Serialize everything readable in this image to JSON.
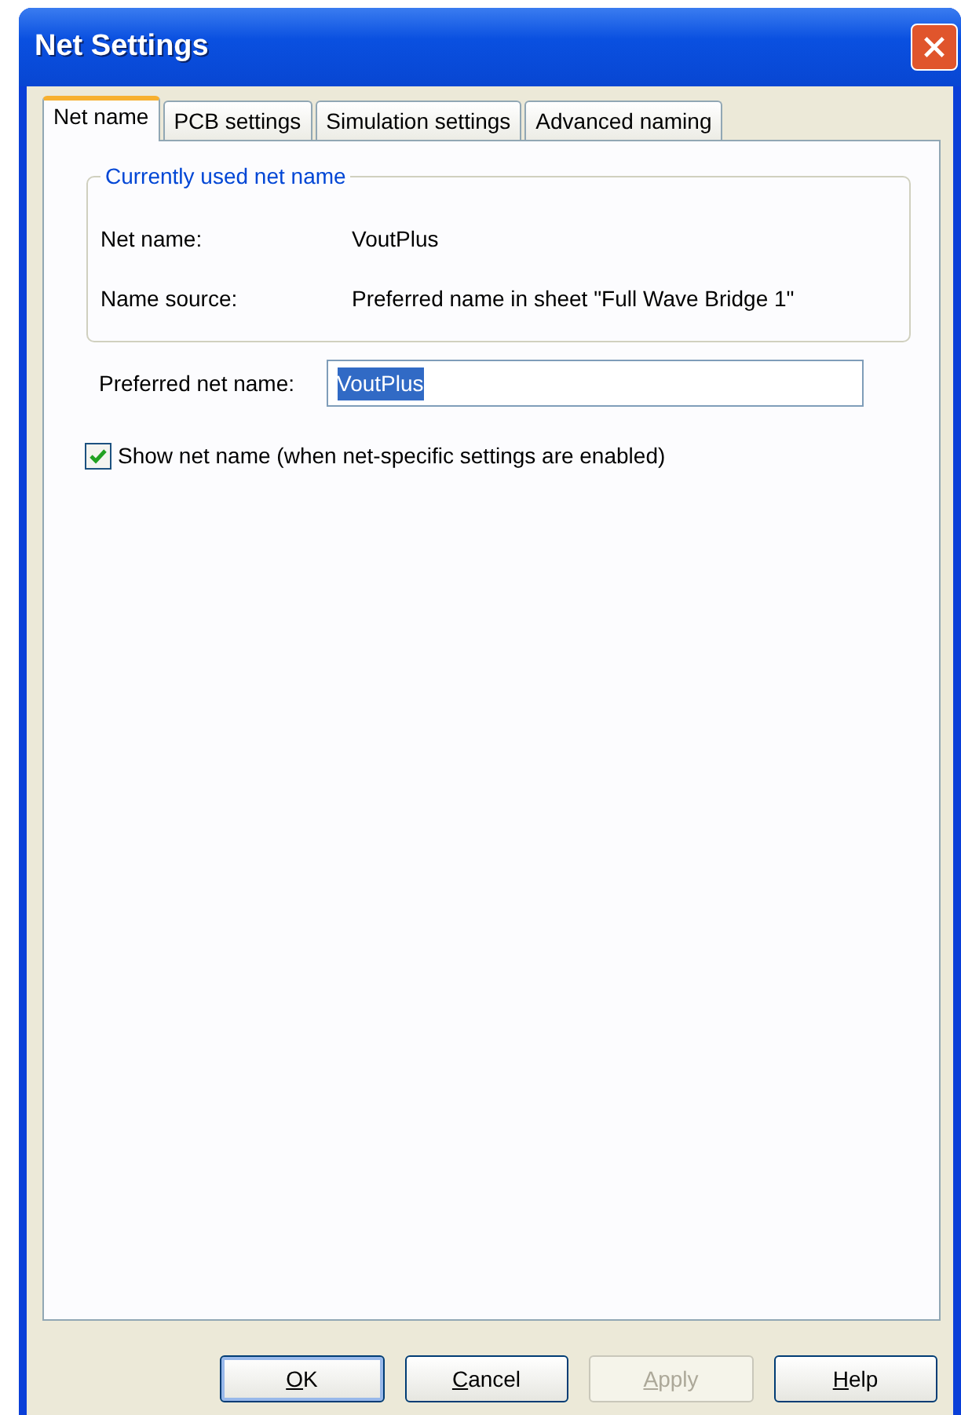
{
  "window": {
    "title": "Net Settings"
  },
  "tabs": [
    {
      "label": "Net name",
      "selected": true
    },
    {
      "label": "PCB settings",
      "selected": false
    },
    {
      "label": "Simulation settings",
      "selected": false
    },
    {
      "label": "Advanced naming",
      "selected": false
    }
  ],
  "group": {
    "title": "Currently used net name",
    "rows": [
      {
        "label": "Net name:",
        "value": "VoutPlus"
      },
      {
        "label": "Name source:",
        "value": "Preferred name in sheet \"Full Wave Bridge 1\""
      }
    ]
  },
  "preferred": {
    "label": "Preferred net name:",
    "value": "VoutPlus",
    "text_selected": true
  },
  "show_net_name": {
    "label": "Show net name (when net-specific settings are enabled)",
    "checked": true
  },
  "buttons": [
    {
      "label": "OK",
      "default": true,
      "disabled": false,
      "underline_first": true
    },
    {
      "label": "Cancel",
      "default": false,
      "disabled": false,
      "underline_first": true
    },
    {
      "label": "Apply",
      "default": false,
      "disabled": true,
      "underline_first": true
    },
    {
      "label": "Help",
      "default": false,
      "disabled": false,
      "underline_first": true
    }
  ]
}
